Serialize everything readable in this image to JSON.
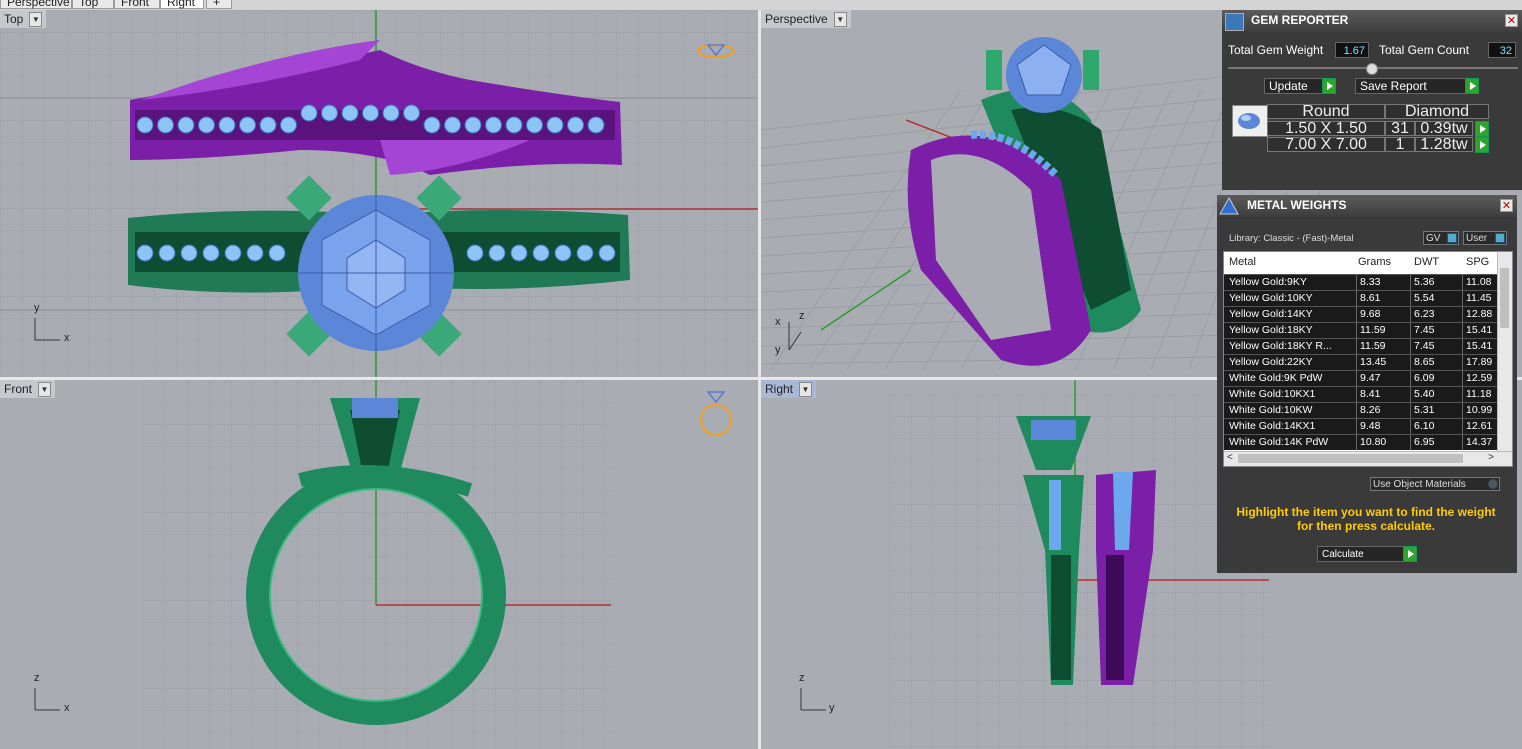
{
  "tabs": [
    "Perspective",
    "Top",
    "Front",
    "Right",
    "+"
  ],
  "viewports": {
    "top": {
      "label": "Top",
      "axis_x": "x",
      "axis_y": "y"
    },
    "perspective": {
      "label": "Perspective",
      "axis_x": "x",
      "axis_y": "y",
      "axis_z": "z"
    },
    "front": {
      "label": "Front",
      "axis_x": "x",
      "axis_z": "z"
    },
    "right": {
      "label": "Right",
      "axis_y": "y",
      "axis_z": "z"
    }
  },
  "gem_reporter": {
    "title": "GEM REPORTER",
    "close": "✕",
    "total_weight_label": "Total Gem Weight",
    "total_weight_value": "1.67",
    "total_count_label": "Total Gem Count",
    "total_count_value": "32",
    "update_label": "Update",
    "save_label": "Save Report",
    "headers": [
      "Round",
      "Diamond"
    ],
    "rows": [
      {
        "size": "1.50 X 1.50",
        "count": "31",
        "tw": "0.39tw"
      },
      {
        "size": "7.00 X 7.00",
        "count": "1",
        "tw": "1.28tw"
      }
    ]
  },
  "metal_weights": {
    "title": "METAL WEIGHTS",
    "close": "✕",
    "library": "Library: Classic - (Fast)-Metal",
    "gv_label": "GV",
    "user_label": "User",
    "columns": [
      "Metal",
      "Grams",
      "DWT",
      "SPG"
    ],
    "rows": [
      [
        "Yellow Gold:9KY",
        "8.33",
        "5.36",
        "11.08"
      ],
      [
        "Yellow Gold:10KY",
        "8.61",
        "5.54",
        "11.45"
      ],
      [
        "Yellow Gold:14KY",
        "9.68",
        "6.23",
        "12.88"
      ],
      [
        "Yellow Gold:18KY",
        "11.59",
        "7.45",
        "15.41"
      ],
      [
        "Yellow Gold:18KY R...",
        "11.59",
        "7.45",
        "15.41"
      ],
      [
        "Yellow Gold:22KY",
        "13.45",
        "8.65",
        "17.89"
      ],
      [
        "White Gold:9K PdW",
        "9.47",
        "6.09",
        "12.59"
      ],
      [
        "White Gold:10KX1",
        "8.41",
        "5.40",
        "11.18"
      ],
      [
        "White Gold:10KW",
        "8.26",
        "5.31",
        "10.99"
      ],
      [
        "White Gold:14KX1",
        "9.48",
        "6.10",
        "12.61"
      ],
      [
        "White Gold:14K PdW",
        "10.80",
        "6.95",
        "14.37"
      ]
    ],
    "use_object_materials": "Use Object Materials",
    "hint": "Highlight the item you want to find the weight for then press calculate.",
    "calculate_label": "Calculate"
  },
  "colors": {
    "green_ring": "#2f9f6d",
    "purple_ring": "#8a2ab8",
    "gem_blue": "#6f9ee6",
    "small_gem": "#8cc4f5",
    "viewport_bg": "#a9adb3"
  }
}
